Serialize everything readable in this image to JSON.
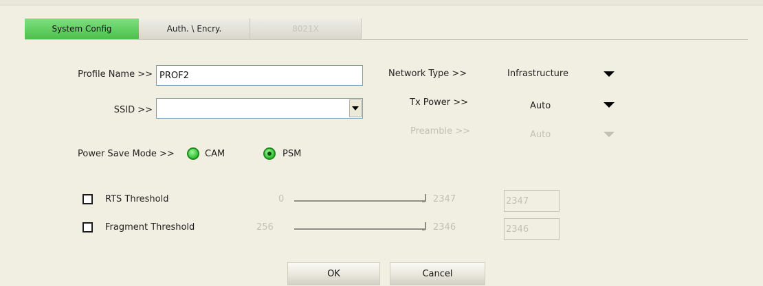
{
  "tabs": [
    {
      "label": "System Config",
      "active": true
    },
    {
      "label": "Auth. \\ Encry.",
      "active": false
    },
    {
      "label": "8021X",
      "active": false,
      "disabled": true
    }
  ],
  "profile": {
    "label": "Profile Name >>",
    "value": "PROF2"
  },
  "ssid": {
    "label": "SSID >>",
    "value": ""
  },
  "power_save": {
    "label": "Power Save Mode >>",
    "options": [
      "CAM",
      "PSM"
    ],
    "selected": "PSM"
  },
  "network_type": {
    "label": "Network Type >>",
    "value": "Infrastructure"
  },
  "tx_power": {
    "label": "Tx Power >>",
    "value": "Auto"
  },
  "preamble": {
    "label": "Preamble >>",
    "value": "Auto",
    "disabled": true
  },
  "rts": {
    "label": "RTS Threshold",
    "checked": false,
    "min": "0",
    "max": "2347",
    "value": "2347"
  },
  "fragment": {
    "label": "Fragment Threshold",
    "checked": false,
    "min": "256",
    "max": "2346",
    "value": "2346"
  },
  "buttons": {
    "ok": "OK",
    "cancel": "Cancel"
  },
  "colors": {
    "active_tab": "#4cc04c",
    "background": "#f1efe2"
  }
}
